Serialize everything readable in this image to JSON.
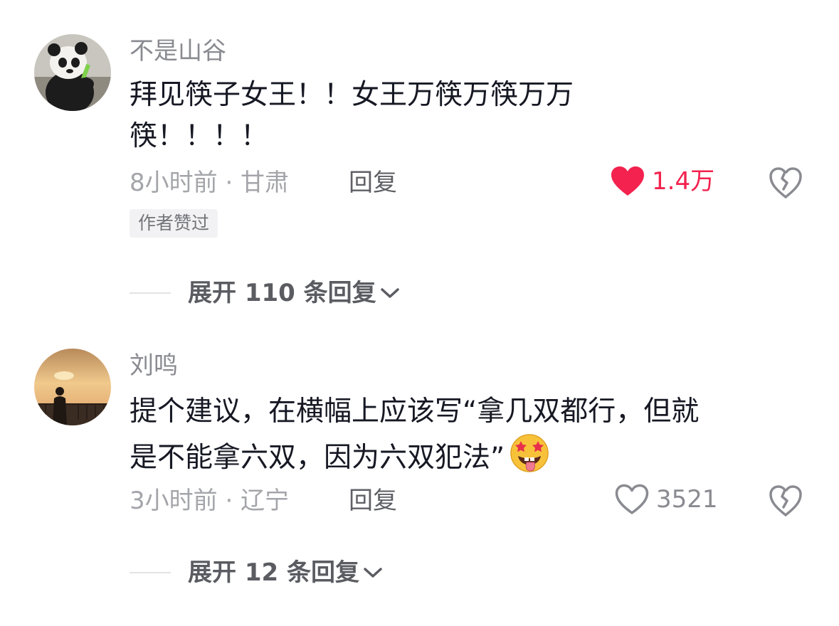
{
  "comments": [
    {
      "username": "不是山谷",
      "text_line1": "拜见筷子女王！！女王万筷万筷万万",
      "text_line2": "筷！！！！",
      "time_location": "8小时前 · 甘肃",
      "reply_label": "回复",
      "like_count": "1.4万",
      "liked": true,
      "badge": "作者赞过",
      "expand_label": "展开 110 条回复",
      "avatar_icon": "panda-avatar",
      "like_color": "#f3224e"
    },
    {
      "username": "刘鸣",
      "text_line1": "提个建议，在横幅上应该写“拿几双都行，但就",
      "text_line2": "是不能拿六双，因为六双犯法”",
      "emoji": "star-struck-tongue-emoji",
      "time_location": "3小时前 · 辽宁",
      "reply_label": "回复",
      "like_count": "3521",
      "liked": false,
      "expand_label": "展开 12 条回复",
      "avatar_icon": "sunset-person-avatar"
    }
  ]
}
